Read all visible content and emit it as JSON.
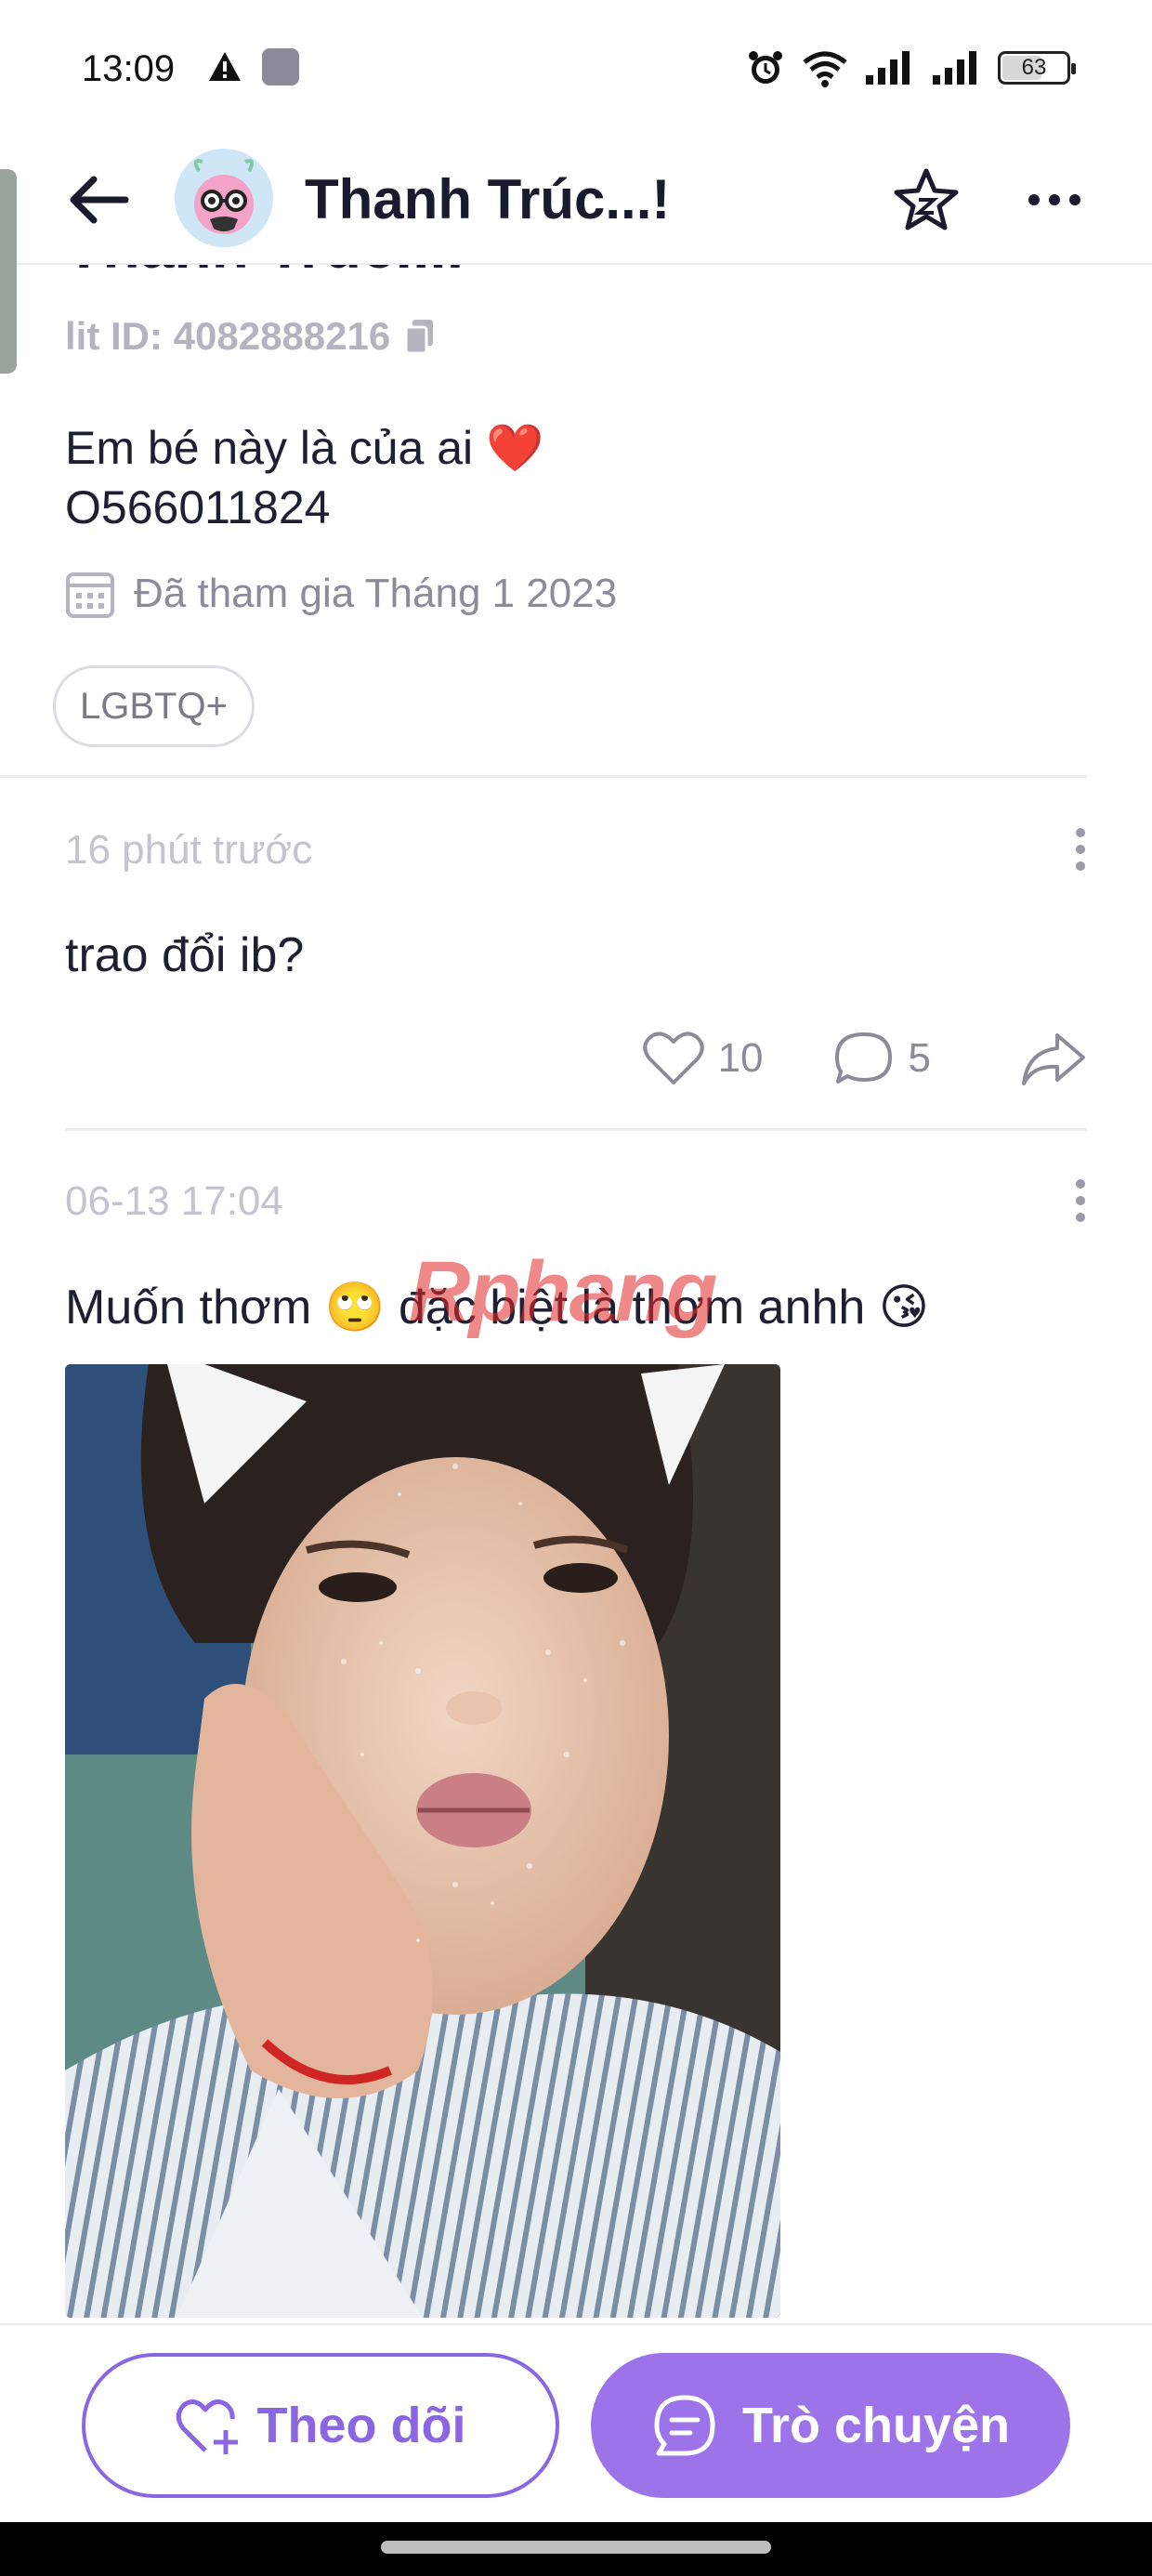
{
  "status_bar": {
    "time": "13:09",
    "battery": "63",
    "battery_level_percent": 63
  },
  "header": {
    "title": "Thanh Trúc...!",
    "back_icon": "arrow-left-icon",
    "star_icon": "star-icon",
    "more_icon": "more-horizontal-icon"
  },
  "profile": {
    "name_cut": "Thanh Trúc....",
    "lit_id": "lit ID: 4082888216",
    "bio_line1": "Em bé này là của ai ❤️",
    "bio_line2": "O566011824",
    "joined": "Đã tham gia Tháng 1 2023",
    "tags": [
      "LGBTQ+"
    ]
  },
  "posts": [
    {
      "time": "16 phút trước",
      "text": "trao đổi ib?",
      "likes": "10",
      "comments": "5"
    },
    {
      "time": "06-13 17:04",
      "text": "Muốn thơm 🙄 đặc biệt là thơm anhh 😘",
      "watermark": "Rphang"
    }
  ],
  "bottom_bar": {
    "follow_label": "Theo dõi",
    "chat_label": "Trò chuyện"
  },
  "colors": {
    "accent": "#9d73ea",
    "accent_outline": "#8b66e2",
    "muted_text": "#8c8c99"
  }
}
